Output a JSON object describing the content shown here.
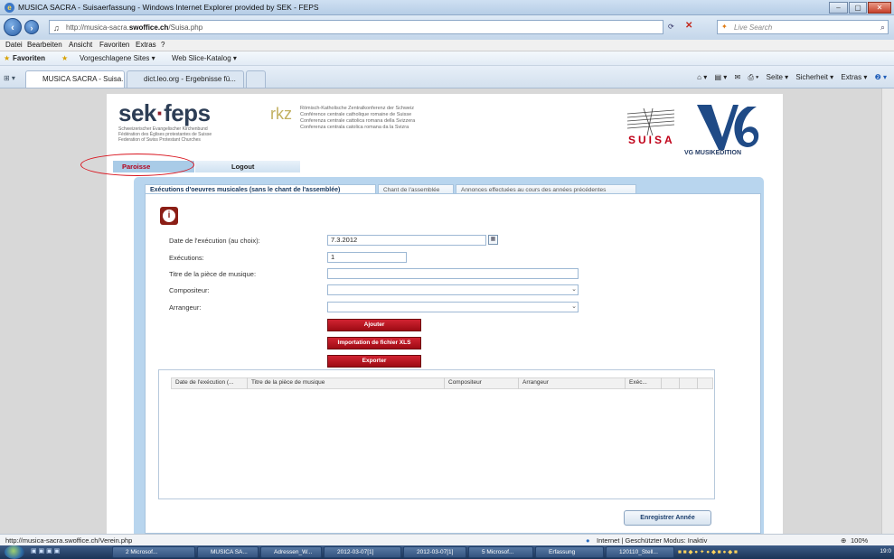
{
  "window": {
    "title": "MUSICA SACRA - Suisaerfassung - Windows Internet Explorer provided by SEK - FEPS",
    "controls": [
      "–",
      "▢",
      "✕"
    ]
  },
  "navigation": {
    "address": "http://musica-sacra.swoffice.ch/Suisa.php",
    "address_prefix": "http://musica-sacra.",
    "address_domain": "swoffice.ch",
    "address_path": "/Suisa.php",
    "search_placeholder": "Live Search"
  },
  "menu": [
    "Datei",
    "Bearbeiten",
    "Ansicht",
    "Favoriten",
    "Extras",
    "?"
  ],
  "favorites": {
    "label": "Favoriten",
    "items": [
      "Vorgeschlagene Sites ▾",
      "Web Slice-Katalog ▾"
    ]
  },
  "browser_tabs": [
    {
      "label": "MUSICA SACRA - Suisa...",
      "active": true
    },
    {
      "label": "dict.leo.org - Ergebnisse fü...",
      "active": false
    }
  ],
  "command_bar": [
    "Seite ▾",
    "Sicherheit ▾",
    "Extras ▾"
  ],
  "header": {
    "logo_main_a": "sek",
    "logo_main_dot": "·",
    "logo_main_b": "feps",
    "logo_lines": [
      "Schweizerischer Evangelischer Kirchenbund",
      "Fédération des Églises protestantes de Suisse",
      "Federation of Swiss Protestant Churches"
    ],
    "rkz": "rkz",
    "rkz_lines": [
      "Römisch-Katholische Zentralkonferenz der Schweiz",
      "Conférence centrale catholique romaine de Suisse",
      "Conferenza centrale cattolica romana della Svizzera",
      "Conferenza centrala catolica romana da la Svizra"
    ],
    "suisa": "SUISA",
    "vg": "VG MUSIKEDITION"
  },
  "page_tabs": {
    "paroisse": "Paroisse",
    "logout": "Logout"
  },
  "content_tabs": [
    "Exécutions d'oeuvres musicales (sans le chant de l'assemblée)",
    "Chant de l'assemblée",
    "Annonces effectuées au cours des années précédentes"
  ],
  "form": {
    "date_label": "Date de l'exécution (au choix):",
    "date_value": "7.3.2012",
    "executions_label": "Exécutions:",
    "executions_value": "1",
    "titre_label": "Titre de la pièce de musique:",
    "titre_value": "",
    "compositeur_label": "Compositeur:",
    "compositeur_value": "",
    "arrangeur_label": "Arrangeur:",
    "arrangeur_value": ""
  },
  "buttons": {
    "ajouter": "Ajouter",
    "import": "Importation de fichier XLS",
    "exporter": "Exporter",
    "save": "Enregistrer Année"
  },
  "grid": {
    "columns": [
      "Date de l'exécution (...",
      "Titre de la pièce de musique",
      "Compositeur",
      "Arrangeur",
      "Exéc...",
      "",
      ""
    ]
  },
  "status": {
    "url": "http://musica-sacra.swoffice.ch/Verein.php",
    "zone": "Internet | Geschützter Modus: Inaktiv",
    "zoom": "100%"
  },
  "taskbar": {
    "items": [
      "2 Microsof...",
      "MUSICA SA...",
      "Adressen_W...",
      "2012-03-07[1]",
      "2012-03-07[1]",
      "5 Microsof...",
      "Erfassung",
      "120110_Stell..."
    ],
    "clock": "19:0"
  },
  "colors": {
    "brand_red": "#b3001b",
    "brand_navy": "#2c3d55",
    "panel_blue": "#b8d5ee",
    "annotation_red": "#d9141e"
  }
}
